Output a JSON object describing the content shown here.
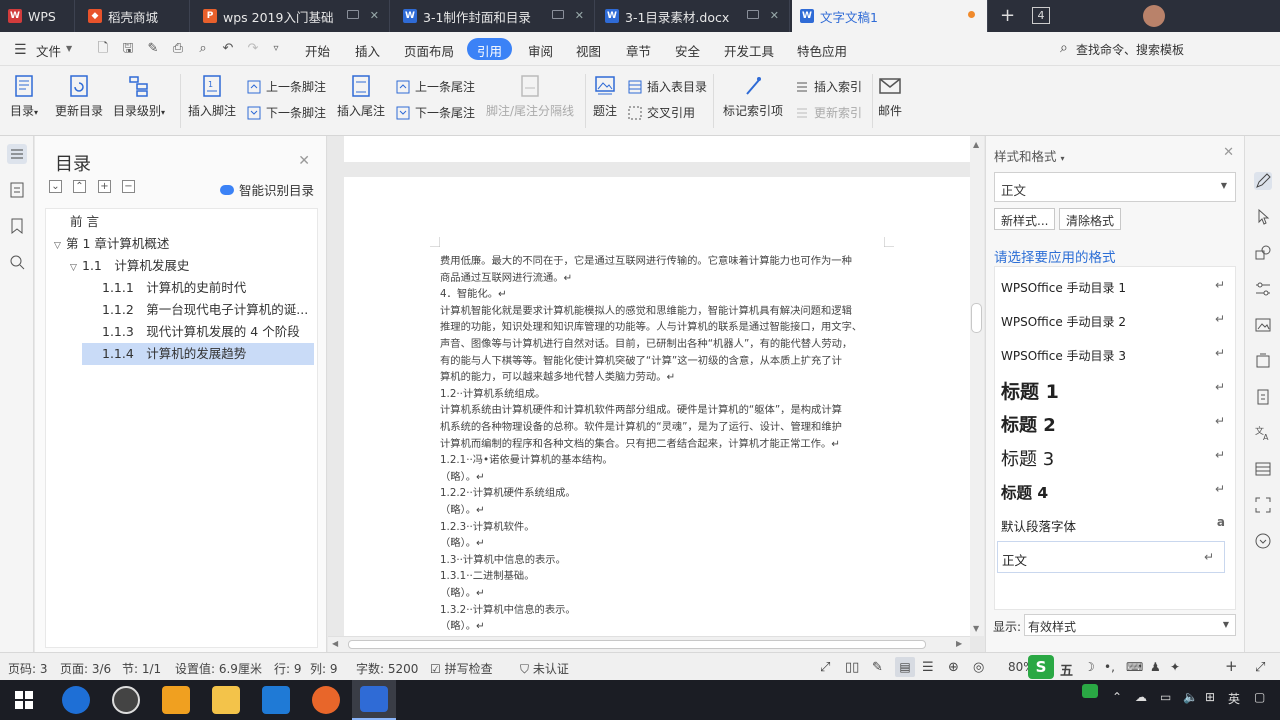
{
  "tabs": [
    {
      "label": "WPS",
      "icon": "wps-logo-icon",
      "color": "#d23c3c"
    },
    {
      "label": "稻壳商城",
      "icon": "docer-icon",
      "color": "#e8532b"
    },
    {
      "label": "wps 2019入门基础",
      "icon": "ppt-file-icon",
      "color": "#e8602c"
    },
    {
      "label": "3-1制作封面和目录",
      "icon": "word-file-icon",
      "color": "#2f6bd6"
    },
    {
      "label": "3-1目录素材.docx",
      "icon": "word-file-icon",
      "color": "#2f6bd6"
    },
    {
      "label": "文字文稿1",
      "icon": "word-file-icon",
      "color": "#2f6bd6"
    }
  ],
  "tabbar": {
    "add": "+",
    "window_count": "4"
  },
  "menu": {
    "file": "文件",
    "items": [
      "开始",
      "插入",
      "页面布局",
      "引用",
      "审阅",
      "视图",
      "章节",
      "安全",
      "开发工具",
      "特色应用"
    ],
    "active": "引用",
    "search": "查找命令、搜索模板"
  },
  "ribbon": {
    "toc": "目录",
    "update_toc": "更新目录",
    "toc_level": "目录级别",
    "insert_footnote": "插入脚注",
    "prev_footnote": "上一条脚注",
    "next_footnote": "下一条脚注",
    "insert_endnote": "插入尾注",
    "prev_endnote": "上一条尾注",
    "next_endnote": "下一条尾注",
    "separator": "脚注/尾注分隔线",
    "caption": "题注",
    "insert_table_toc": "插入表目录",
    "cross_ref": "交叉引用",
    "mark_index": "标记索引项",
    "insert_index": "插入索引",
    "update_index": "更新索引",
    "mail": "邮件"
  },
  "toc_panel": {
    "title": "目录",
    "smart": "智能识别目录",
    "items": [
      {
        "label": "前 言",
        "level": 0
      },
      {
        "label": "第 1 章计算机概述",
        "level": 0
      },
      {
        "label": "1.1　计算机发展史",
        "level": 1
      },
      {
        "label": "1.1.1　计算机的史前时代",
        "level": 2
      },
      {
        "label": "1.1.2　第一台现代电子计算机的诞...",
        "level": 2
      },
      {
        "label": "1.1.3　现代计算机发展的 4 个阶段",
        "level": 2
      },
      {
        "label": "1.1.4　计算机的发展趋势",
        "level": 2,
        "selected": true
      }
    ]
  },
  "document": {
    "lines": [
      "费用低廉。最大的不同在于，它是通过互联网进行传输的。它意味着计算能力也可作为一种",
      "商品通过互联网进行流通。↵",
      "4．智能化。↵",
      "计算机智能化就是要求计算机能模拟人的感觉和思维能力，智能计算机具有解决问题和逻辑",
      "推理的功能，知识处理和知识库管理的功能等。人与计算机的联系是通过智能接口，用文字、",
      "声音、图像等与计算机进行自然对话。目前，已研制出各种“机器人”，有的能代替人劳动，",
      "有的能与人下棋等等。智能化使计算机突破了“计算”这一初级的含意，从本质上扩充了计",
      "算机的能力，可以越来越多地代替人类脑力劳动。↵",
      "1.2··计算机系统组成。",
      "计算机系统由计算机硬件和计算机软件两部分组成。硬件是计算机的“躯体”，是构成计算",
      "机系统的各种物理设备的总称。软件是计算机的“灵魂”，是为了运行、设计、管理和维护",
      "计算机而编制的程序和各种文档的集合。只有把二者结合起来，计算机才能正常工作。↵",
      "1.2.1··冯•诺依曼计算机的基本结构。",
      "（略）。↵",
      "1.2.2··计算机硬件系统组成。",
      "（略）。↵",
      "1.2.3··计算机软件。",
      "（略）。↵",
      "1.3··计算机中信息的表示。",
      "1.3.1··二进制基础。",
      "（略）。↵",
      "1.3.2··计算机中信息的表示。",
      "（略）。↵"
    ]
  },
  "styles_panel": {
    "title": "样式和格式",
    "current": "正文",
    "new_style": "新样式...",
    "clear_format": "清除格式",
    "prompt": "请选择要应用的格式",
    "items": [
      {
        "label": "WPSOffice 手动目录 1",
        "kind": "toc"
      },
      {
        "label": "WPSOffice 手动目录 2",
        "kind": "toc"
      },
      {
        "label": "WPSOffice 手动目录 3",
        "kind": "toc"
      },
      {
        "label": "标题 1",
        "kind": "h1"
      },
      {
        "label": "标题 2",
        "kind": "h2"
      },
      {
        "label": "标题 3",
        "kind": "h3"
      },
      {
        "label": "标题 4",
        "kind": "h4"
      },
      {
        "label": "默认段落字体",
        "kind": "char"
      },
      {
        "label": "正文",
        "kind": "normal"
      }
    ],
    "show_label": "显示:",
    "show_value": "有效样式"
  },
  "status": {
    "page_no": "页码: 3",
    "page": "页面: 3/6",
    "section": "节: 1/1",
    "setting": "设置值: 6.9厘米",
    "row": "行: 9",
    "col": "列: 9",
    "words": "字数: 5200",
    "spell": "拼写检查",
    "auth": "未认证",
    "zoom": "80%",
    "ime": "五"
  },
  "colors": {
    "accent": "#3b82f6",
    "tabbar": "#2b2f3a",
    "selection": "#c9dbf7",
    "prompt": "#2d6fd6"
  }
}
